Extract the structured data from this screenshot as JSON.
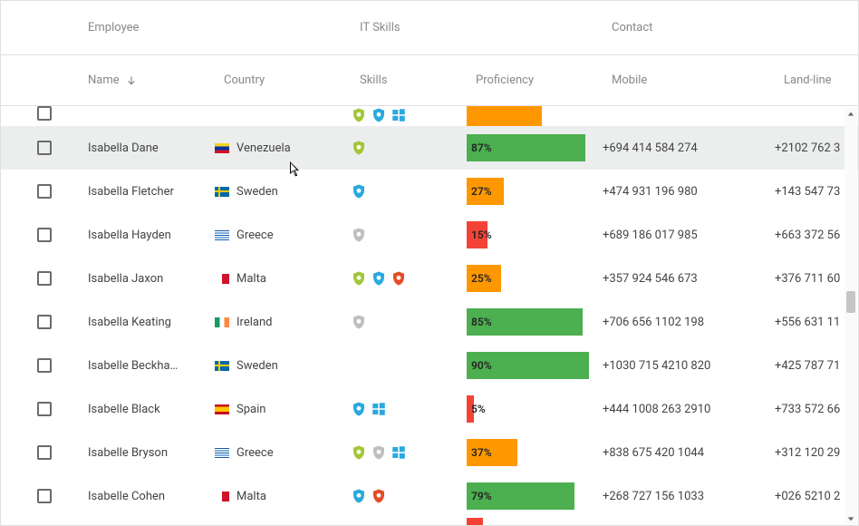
{
  "groups": {
    "employee": "Employee",
    "it": "IT Skills",
    "contact": "Contact"
  },
  "columns": {
    "name": "Name",
    "country": "Country",
    "skills": "Skills",
    "proficiency": "Proficiency",
    "mobile": "Mobile",
    "landline": "Land-line"
  },
  "sort": {
    "column": "name",
    "direction": "asc"
  },
  "scrollbar": {
    "thumb_position_pct": 46
  },
  "rows": [
    {
      "partial": "top",
      "checked": false,
      "name": "",
      "country": "",
      "flag": "",
      "skills": [
        "android",
        "css",
        "windows"
      ],
      "proficiency": 55,
      "prof_color": "orange",
      "mobile": "",
      "landline": ""
    },
    {
      "hover": true,
      "checked": false,
      "name": "Isabella Dane",
      "country": "Venezuela",
      "flag": "ve",
      "skills": [
        "android"
      ],
      "proficiency": 87,
      "prof_color": "green",
      "mobile": "+694 414 584 274",
      "landline": "+2102 762 3"
    },
    {
      "checked": false,
      "name": "Isabella Fletcher",
      "country": "Sweden",
      "flag": "se",
      "skills": [
        "css"
      ],
      "proficiency": 27,
      "prof_color": "orange",
      "mobile": "+474 931 196 980",
      "landline": "+143 547 73"
    },
    {
      "checked": false,
      "name": "Isabella Hayden",
      "country": "Greece",
      "flag": "gr",
      "skills": [
        "apple-gray"
      ],
      "proficiency": 15,
      "prof_color": "red",
      "mobile": "+689 186 017 985",
      "landline": "+663 372 56"
    },
    {
      "checked": false,
      "name": "Isabella Jaxon",
      "country": "Malta",
      "flag": "mt",
      "skills": [
        "android",
        "css",
        "html5"
      ],
      "proficiency": 25,
      "prof_color": "orange",
      "mobile": "+357 924 546 673",
      "landline": "+376 711 60"
    },
    {
      "checked": false,
      "name": "Isabella Keating",
      "country": "Ireland",
      "flag": "ie",
      "skills": [
        "apple-gray"
      ],
      "proficiency": 85,
      "prof_color": "green",
      "mobile": "+706 656 1102 198",
      "landline": "+556 631 11"
    },
    {
      "checked": false,
      "name": "Isabelle Beckha…",
      "country": "Sweden",
      "flag": "se",
      "skills": [],
      "proficiency": 90,
      "prof_color": "green",
      "mobile": "+1030 715 4210 820",
      "landline": "+425 787 71"
    },
    {
      "checked": false,
      "name": "Isabelle Black",
      "country": "Spain",
      "flag": "es",
      "skills": [
        "css",
        "windows"
      ],
      "proficiency": 5,
      "prof_color": "red",
      "mobile": "+444 1008 263 2910",
      "landline": "+733 572 66"
    },
    {
      "checked": false,
      "name": "Isabelle Bryson",
      "country": "Greece",
      "flag": "gr",
      "skills": [
        "android",
        "apple-gray",
        "windows"
      ],
      "proficiency": 37,
      "prof_color": "orange",
      "mobile": "+838 675 420 1044",
      "landline": "+312 120 29"
    },
    {
      "checked": false,
      "name": "Isabelle Cohen",
      "country": "Malta",
      "flag": "mt",
      "skills": [
        "css",
        "html5"
      ],
      "proficiency": 79,
      "prof_color": "green",
      "mobile": "+268 727 156 1033",
      "landline": "+026 5210 2"
    },
    {
      "partial": "bot",
      "checked": false,
      "name": "",
      "country": "",
      "flag": "",
      "skills": [],
      "proficiency": 12,
      "prof_color": "red",
      "mobile": "",
      "landline": ""
    }
  ],
  "icon_colors": {
    "android": "#a4c639",
    "css": "#2aa9e0",
    "html5": "#e44d26",
    "windows": "#2aa9e0",
    "apple-gray": "#bfbfbf"
  }
}
